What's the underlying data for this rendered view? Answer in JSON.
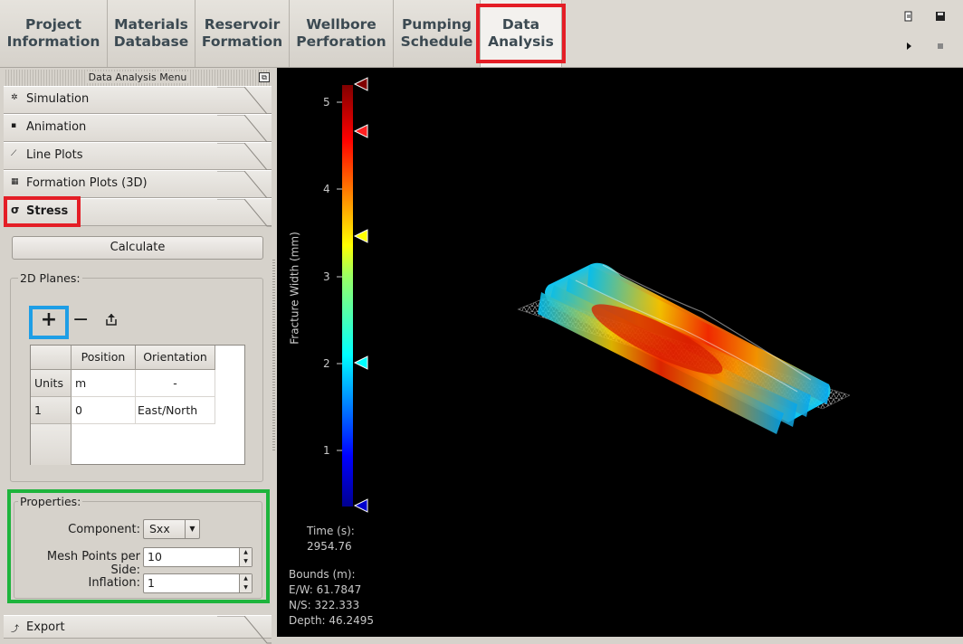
{
  "tabs": [
    {
      "line1": "Project",
      "line2": "Information"
    },
    {
      "line1": "Materials",
      "line2": "Database"
    },
    {
      "line1": "Reservoir",
      "line2": "Formation"
    },
    {
      "line1": "Wellbore",
      "line2": "Perforation"
    },
    {
      "line1": "Pumping",
      "line2": "Schedule"
    },
    {
      "line1": "Data",
      "line2": "Analysis"
    }
  ],
  "toolbar_icons": [
    "export-icon",
    "save-icon",
    "play-icon",
    "stop-icon"
  ],
  "menu": {
    "title": "Data Analysis Menu",
    "items": [
      {
        "label": "Simulation",
        "icon": "gear-icon"
      },
      {
        "label": "Animation",
        "icon": "camera-icon"
      },
      {
        "label": "Line Plots",
        "icon": "chart-icon"
      },
      {
        "label": "Formation Plots (3D)",
        "icon": "grid-icon"
      },
      {
        "label": "Stress",
        "icon": "sigma-icon",
        "glyph": "σ"
      },
      {
        "label": "Export",
        "icon": "export-icon"
      }
    ]
  },
  "calculate_label": "Calculate",
  "planes": {
    "title": "2D Planes:",
    "columns": [
      "Position",
      "Orientation"
    ],
    "rows": [
      {
        "header": "Units",
        "position": "m",
        "orientation": "-"
      },
      {
        "header": "1",
        "position": "0",
        "orientation": "East/North"
      }
    ]
  },
  "properties": {
    "title": "Properties:",
    "component_label": "Component:",
    "component_value": "Sxx",
    "mesh_label": "Mesh Points per Side:",
    "mesh_value": "10",
    "inflation_label": "Inflation:",
    "inflation_value": "1"
  },
  "colorbar": {
    "label": "Fracture Width (mm)",
    "ticks": [
      "5",
      "4",
      "3",
      "2",
      "1"
    ],
    "colormap": "jet"
  },
  "info": {
    "time_label": "Time (s):",
    "time_value": "2954.76",
    "bounds_label": "Bounds (m):",
    "ew": "E/W: 61.7847",
    "ns": "N/S: 322.333",
    "depth": "Depth: 46.2495"
  },
  "colors": {
    "highlight_red": "#e41e26",
    "highlight_blue": "#1e9ee6",
    "highlight_green": "#1eb43c",
    "tab_text": "#3c4a52"
  }
}
